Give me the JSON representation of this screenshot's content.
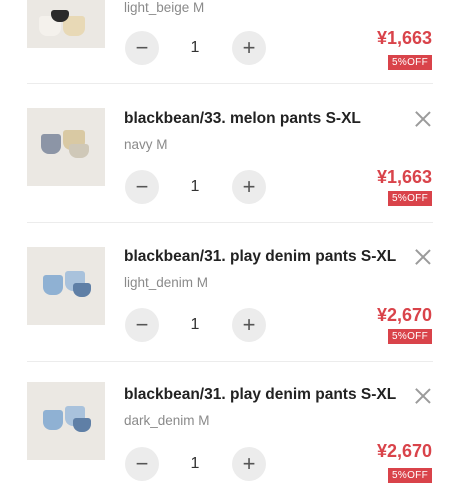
{
  "cart": {
    "items": [
      {
        "title": "",
        "variant": "light_beige M",
        "quantity": "1",
        "price": "¥1,663",
        "discount": "5%OFF",
        "thumb_colors": [
          "#f4f1ec",
          "#e8d9b6",
          "#2b2b2b"
        ]
      },
      {
        "title": "blackbean/33. melon pants S-XL",
        "variant": "navy M",
        "quantity": "1",
        "price": "¥1,663",
        "discount": "5%OFF",
        "thumb_colors": [
          "#8c95a6",
          "#d9c9a3",
          "#cfc8b8"
        ]
      },
      {
        "title": "blackbean/31. play denim pants S-XL",
        "variant": "light_denim M",
        "quantity": "1",
        "price": "¥2,670",
        "discount": "5%OFF",
        "thumb_colors": [
          "#8fb1d3",
          "#5f7fa6",
          "#a9c2dc"
        ]
      },
      {
        "title": "blackbean/31. play denim pants S-XL",
        "variant": "dark_denim M",
        "quantity": "1",
        "price": "¥2,670",
        "discount": "5%OFF",
        "thumb_colors": [
          "#8fb1d3",
          "#5f7fa6",
          "#a9c2dc"
        ]
      }
    ],
    "icons": {
      "minus": "minus-icon",
      "plus": "plus-icon",
      "remove": "close-icon"
    },
    "accent_color": "#d9434a"
  }
}
